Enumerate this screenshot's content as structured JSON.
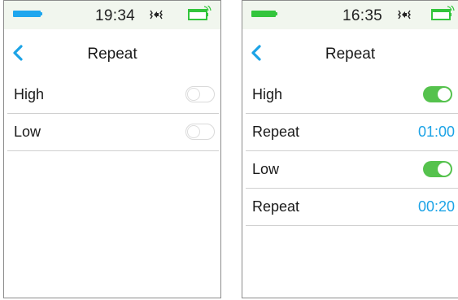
{
  "colors": {
    "battery": "#1ea6ee",
    "battery_right": "#33c53c",
    "accent_blue": "#1ca3e6",
    "toggle_on": "#55c24d",
    "statusbar_bg": "#f1f6ee"
  },
  "left_screen": {
    "status": {
      "time": "19:34",
      "battery_icon": "battery-icon",
      "vibrate_icon": "vibrate-icon",
      "reservoir_icon": "reservoir-icon"
    },
    "nav": {
      "back_icon": "chevron-left-icon",
      "title": "Repeat"
    },
    "rows": [
      {
        "label": "High",
        "toggle": "off"
      },
      {
        "label": "Low",
        "toggle": "off"
      }
    ]
  },
  "right_screen": {
    "status": {
      "time": "16:35",
      "battery_icon": "battery-icon",
      "vibrate_icon": "vibrate-icon",
      "reservoir_icon": "reservoir-icon"
    },
    "nav": {
      "back_icon": "chevron-left-icon",
      "title": "Repeat"
    },
    "rows": [
      {
        "label": "High",
        "toggle": "on"
      },
      {
        "label": "Repeat",
        "value": "01:00"
      },
      {
        "label": "Low",
        "toggle": "on"
      },
      {
        "label": "Repeat",
        "value": "00:20"
      }
    ]
  }
}
